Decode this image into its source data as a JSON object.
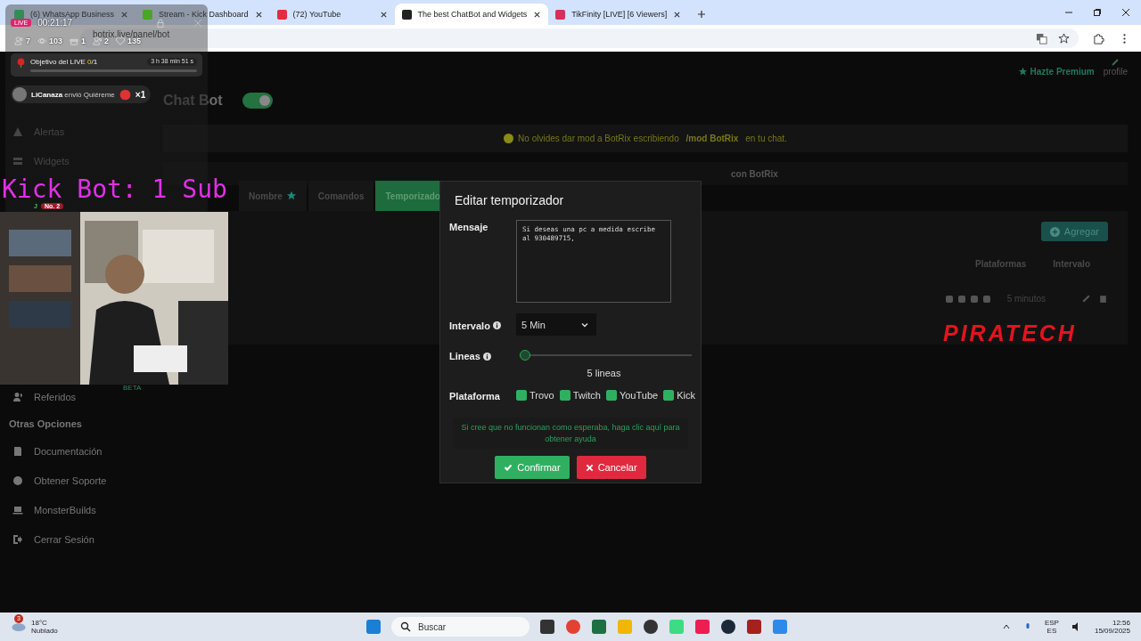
{
  "browser": {
    "tabs": [
      {
        "title": "(6) WhatsApp Business",
        "kind": "whatsapp",
        "selected": false
      },
      {
        "title": "Stream - Kick Dashboard",
        "kind": "kick",
        "selected": false
      },
      {
        "title": "(72) YouTube",
        "kind": "youtube",
        "selected": false
      },
      {
        "title": "The best ChatBot and Widgets",
        "kind": "botrix",
        "selected": true
      },
      {
        "title": "TikFinity [LIVE] [6 Viewers]",
        "kind": "tikfinity",
        "selected": false
      }
    ],
    "address": "botrix.live/panel/bot"
  },
  "stream_overlay": {
    "live_badge": "LIVE",
    "timer": "00:21:17",
    "stats": [
      {
        "kind": "users",
        "value": "7"
      },
      {
        "kind": "views",
        "value": "103"
      },
      {
        "kind": "gift",
        "value": "1"
      },
      {
        "kind": "follow",
        "value": "2"
      },
      {
        "kind": "likes",
        "value": "135"
      }
    ],
    "goal": {
      "label": "Objetivo del LIVE",
      "current": "0",
      "target": "/1",
      "time_left": "3 h 38 min 51 s",
      "level": 0
    },
    "gift": {
      "user": "LiCanaza",
      "action": "envió Quiéreme",
      "count": "×1"
    },
    "chat": {
      "user_initial": "J",
      "rank": "No. 2"
    },
    "caption": "Kick Bot: 1 Sub",
    "logo": "PIRATECH"
  },
  "page": {
    "premium": "Hazte Premium",
    "profile": "profile",
    "sidebar": [
      {
        "label": "Alertas",
        "kind": "alert"
      },
      {
        "label": "Widgets",
        "kind": "widgets"
      },
      {
        "label": "Referidos",
        "kind": "users",
        "badge": "BETA"
      }
    ],
    "other_heading": "Otras Opciones",
    "other": [
      {
        "label": "Documentación",
        "kind": "docs"
      },
      {
        "label": "Obtener Soporte",
        "kind": "help"
      },
      {
        "label": "MonsterBuilds",
        "kind": "laptop"
      },
      {
        "label": "Cerrar Sesión",
        "kind": "logout"
      }
    ],
    "title": "Chat Bot",
    "bot_on": true,
    "notice": {
      "text": "No olvides dar mod a BotRix escribiendo",
      "command": "/mod BotRix",
      "tail": "en tu chat."
    },
    "notice2": "con BotRix",
    "tabs": [
      {
        "label": "Nombre",
        "premium": true,
        "selected": false
      },
      {
        "label": "Comandos",
        "premium": false,
        "selected": false
      },
      {
        "label": "Temporizado",
        "premium": false,
        "selected": true
      }
    ],
    "add_button": "Agregar",
    "columns": [
      "Plataformas",
      "Intervalo"
    ],
    "rows": [
      {
        "interval": "5 minutos"
      }
    ]
  },
  "modal": {
    "title": "Editar temporizador",
    "message_label": "Mensaje",
    "message": "Si deseas una pc a medida escribe al 930489715, ",
    "interval_label": "Intervalo",
    "interval": "5 Min",
    "lines": {
      "label": "Lineas",
      "level": 0,
      "reading": "5 lineas"
    },
    "platform_label": "Plataforma",
    "platforms": [
      {
        "label": "Trovo",
        "checked": true
      },
      {
        "label": "Twitch",
        "checked": true
      },
      {
        "label": "YouTube",
        "checked": true
      },
      {
        "label": "Kick",
        "checked": true
      }
    ],
    "help": "Si cree que no funcionan como esperaba, haga clic aquí para obtener ayuda",
    "buttons": [
      {
        "label": "Confirmar",
        "kind": "confirm"
      },
      {
        "label": "Cancelar",
        "kind": "cancel"
      }
    ]
  },
  "taskbar": {
    "weather": {
      "badge": "3",
      "temp": "18°C",
      "condition": "Nublado"
    },
    "search": "Buscar",
    "apps": [
      {
        "kind": "windows"
      },
      {
        "kind": "taskview"
      },
      {
        "kind": "chrome"
      },
      {
        "kind": "excel"
      },
      {
        "kind": "folder"
      },
      {
        "kind": "obs"
      },
      {
        "kind": "android"
      },
      {
        "kind": "tiktok"
      },
      {
        "kind": "steam"
      },
      {
        "kind": "dota"
      },
      {
        "kind": "notepad"
      }
    ],
    "lang": "ESP",
    "layout": "ES",
    "time": "12:56",
    "date": "15/09/2025"
  }
}
